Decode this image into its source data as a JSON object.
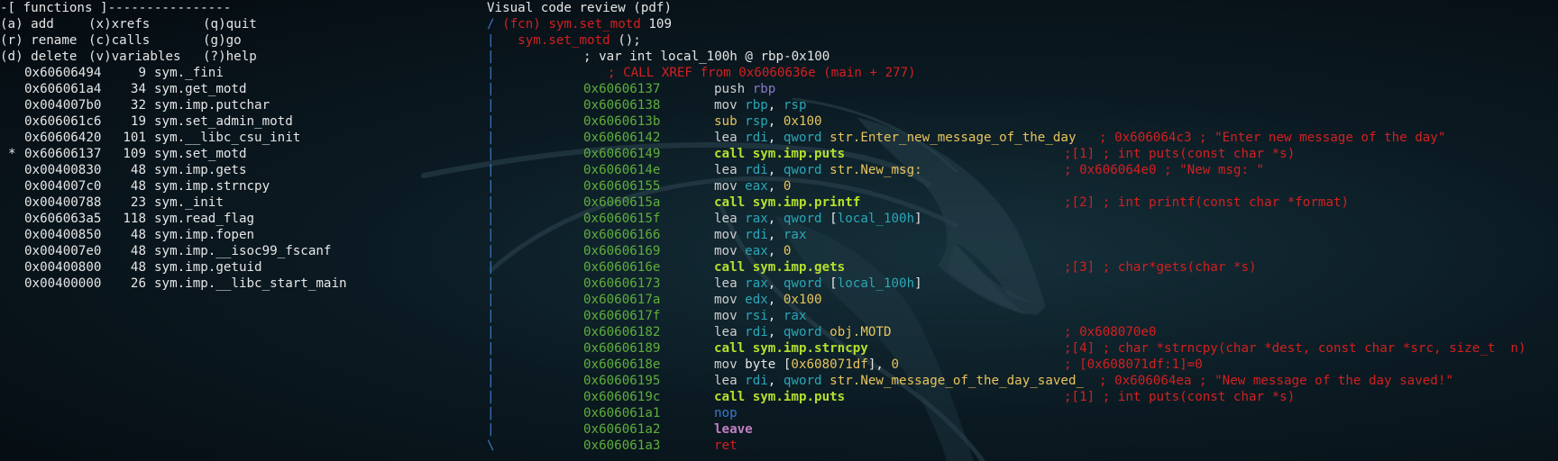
{
  "functions_panel": {
    "header": "-[ functions ]----------------",
    "menu": [
      [
        "(a) add",
        "(x)xrefs",
        "(q)quit"
      ],
      [
        "(r) rename",
        "(c)calls",
        "(g)go"
      ],
      [
        "(d) delete",
        "(v)variables",
        "(?)help"
      ]
    ],
    "list": [
      {
        "marker": "",
        "addr": "0x60606494",
        "size": "9",
        "name": "sym._fini"
      },
      {
        "marker": "",
        "addr": "0x606061a4",
        "size": "34",
        "name": "sym.get_motd"
      },
      {
        "marker": "",
        "addr": "0x004007b0",
        "size": "32",
        "name": "sym.imp.putchar"
      },
      {
        "marker": "",
        "addr": "0x606061c6",
        "size": "19",
        "name": "sym.set_admin_motd"
      },
      {
        "marker": "",
        "addr": "0x60606420",
        "size": "101",
        "name": "sym.__libc_csu_init"
      },
      {
        "marker": "*",
        "addr": "0x60606137",
        "size": "109",
        "name": "sym.set_motd"
      },
      {
        "marker": "",
        "addr": "0x00400830",
        "size": "48",
        "name": "sym.imp.gets"
      },
      {
        "marker": "",
        "addr": "0x004007c0",
        "size": "48",
        "name": "sym.imp.strncpy"
      },
      {
        "marker": "",
        "addr": "0x00400788",
        "size": "23",
        "name": "sym._init"
      },
      {
        "marker": "",
        "addr": "0x606063a5",
        "size": "118",
        "name": "sym.read_flag"
      },
      {
        "marker": "",
        "addr": "0x00400850",
        "size": "48",
        "name": "sym.imp.fopen"
      },
      {
        "marker": "",
        "addr": "0x004007e0",
        "size": "48",
        "name": "sym.imp.__isoc99_fscanf"
      },
      {
        "marker": "",
        "addr": "0x00400800",
        "size": "48",
        "name": "sym.imp.getuid"
      },
      {
        "marker": "",
        "addr": "0x00400000",
        "size": "26",
        "name": "sym.imp.__libc_start_main"
      }
    ]
  },
  "code_panel": {
    "title": "Visual code review (pdf)",
    "fcn_line": {
      "prefix": "/ ",
      "fcn": "(fcn) sym.set_motd",
      "size": " 109"
    },
    "sig_line": {
      "bar": "|",
      "name": "sym.set_motd",
      "rest": " ();"
    },
    "var_line": "; var int local_100h @ rbp-0x100",
    "xref_line": "; CALL XREF from 0x6060636e (main + 277)",
    "instructions": [
      {
        "bar": "|",
        "addr": "0x60606137",
        "mn": "push",
        "ops": [
          [
            " ",
            ""
          ],
          [
            "rbp",
            "purple"
          ]
        ],
        "cmt": ""
      },
      {
        "bar": "|",
        "addr": "0x60606138",
        "mn": "mov",
        "ops": [
          [
            " ",
            ""
          ],
          [
            "rbp",
            "cyan"
          ],
          [
            ", ",
            ""
          ],
          [
            "rsp",
            "cyan"
          ]
        ],
        "cmt": ""
      },
      {
        "bar": "|",
        "addr": "0x6060613b",
        "mn": "sub",
        "mnc": "yel",
        "ops": [
          [
            " ",
            ""
          ],
          [
            "rsp",
            "cyan"
          ],
          [
            ", ",
            ""
          ],
          [
            "0x100",
            "yel"
          ]
        ],
        "cmt": ""
      },
      {
        "bar": "|",
        "addr": "0x60606142",
        "mn": "lea",
        "ops": [
          [
            " ",
            ""
          ],
          [
            "rdi",
            "cyan"
          ],
          [
            ", ",
            ""
          ],
          [
            "qword",
            "cyan"
          ],
          [
            " ",
            ""
          ],
          [
            "str.Enter_new_message_of_the_day",
            "yel"
          ]
        ],
        "cmt": " ; 0x606064c3 ; \"Enter new message of the day\""
      },
      {
        "bar": "|",
        "addr": "0x60606149",
        "mn": "call sym.imp.puts",
        "mnc": "lime",
        "ops": [],
        "cmt": ";[1] ; int puts(const char *s)"
      },
      {
        "bar": "|",
        "addr": "0x6060614e",
        "mn": "lea",
        "ops": [
          [
            " ",
            ""
          ],
          [
            "rdi",
            "cyan"
          ],
          [
            ", ",
            ""
          ],
          [
            "qword",
            "cyan"
          ],
          [
            " ",
            ""
          ],
          [
            "str.New_msg:",
            "yel"
          ]
        ],
        "cmt": "; 0x606064e0 ; \"New msg: \""
      },
      {
        "bar": "|",
        "addr": "0x60606155",
        "mn": "mov",
        "ops": [
          [
            " ",
            ""
          ],
          [
            "eax",
            "cyan"
          ],
          [
            ", ",
            ""
          ],
          [
            "0",
            "yel"
          ]
        ],
        "cmt": ""
      },
      {
        "bar": "|",
        "addr": "0x6060615a",
        "mn": "call sym.imp.printf",
        "mnc": "lime",
        "ops": [],
        "cmt": ";[2] ; int printf(const char *format)"
      },
      {
        "bar": "|",
        "addr": "0x6060615f",
        "mn": "lea",
        "ops": [
          [
            " ",
            ""
          ],
          [
            "rax",
            "cyan"
          ],
          [
            ", ",
            ""
          ],
          [
            "qword",
            "cyan"
          ],
          [
            " [",
            ""
          ],
          [
            "local_100h",
            "cyan"
          ],
          [
            "]",
            ""
          ]
        ],
        "cmt": ""
      },
      {
        "bar": "|",
        "addr": "0x60606166",
        "mn": "mov",
        "ops": [
          [
            " ",
            ""
          ],
          [
            "rdi",
            "cyan"
          ],
          [
            ", ",
            ""
          ],
          [
            "rax",
            "cyan"
          ]
        ],
        "cmt": ""
      },
      {
        "bar": "|",
        "addr": "0x60606169",
        "mn": "mov",
        "ops": [
          [
            " ",
            ""
          ],
          [
            "eax",
            "cyan"
          ],
          [
            ", ",
            ""
          ],
          [
            "0",
            "yel"
          ]
        ],
        "cmt": ""
      },
      {
        "bar": "|",
        "addr": "0x6060616e",
        "mn": "call sym.imp.gets",
        "mnc": "lime",
        "ops": [],
        "cmt": ";[3] ; char*gets(char *s)"
      },
      {
        "bar": "|",
        "addr": "0x60606173",
        "mn": "lea",
        "ops": [
          [
            " ",
            ""
          ],
          [
            "rax",
            "cyan"
          ],
          [
            ", ",
            ""
          ],
          [
            "qword",
            "cyan"
          ],
          [
            " [",
            ""
          ],
          [
            "local_100h",
            "cyan"
          ],
          [
            "]",
            ""
          ]
        ],
        "cmt": ""
      },
      {
        "bar": "|",
        "addr": "0x6060617a",
        "mn": "mov",
        "ops": [
          [
            " ",
            ""
          ],
          [
            "edx",
            "cyan"
          ],
          [
            ", ",
            ""
          ],
          [
            "0x100",
            "yel"
          ]
        ],
        "cmt": ""
      },
      {
        "bar": "|",
        "addr": "0x6060617f",
        "mn": "mov",
        "ops": [
          [
            " ",
            ""
          ],
          [
            "rsi",
            "cyan"
          ],
          [
            ", ",
            ""
          ],
          [
            "rax",
            "cyan"
          ]
        ],
        "cmt": ""
      },
      {
        "bar": "|",
        "addr": "0x60606182",
        "mn": "lea",
        "ops": [
          [
            " ",
            ""
          ],
          [
            "rdi",
            "cyan"
          ],
          [
            ", ",
            ""
          ],
          [
            "qword",
            "cyan"
          ],
          [
            " ",
            ""
          ],
          [
            "obj.MOTD",
            "yel"
          ]
        ],
        "cmt": "; 0x608070e0"
      },
      {
        "bar": "|",
        "addr": "0x60606189",
        "mn": "call sym.imp.strncpy",
        "mnc": "lime",
        "ops": [],
        "cmt": ";[4] ; char *strncpy(char *dest, const char *src, size_t  n)"
      },
      {
        "bar": "|",
        "addr": "0x6060618e",
        "mn": "mov",
        "ops": [
          [
            " byte [",
            ""
          ],
          [
            "0x608071df",
            "yel"
          ],
          [
            "], ",
            ""
          ],
          [
            "0",
            "yel"
          ]
        ],
        "cmt": "; [0x608071df:1]=0"
      },
      {
        "bar": "|",
        "addr": "0x60606195",
        "mn": "lea",
        "ops": [
          [
            " ",
            ""
          ],
          [
            "rdi",
            "cyan"
          ],
          [
            ", ",
            ""
          ],
          [
            "qword",
            "cyan"
          ],
          [
            " ",
            ""
          ],
          [
            "str.New_message_of_the_day_saved_",
            "yel"
          ]
        ],
        "cmt": " ; 0x606064ea ; \"New message of the day saved!\""
      },
      {
        "bar": "|",
        "addr": "0x6060619c",
        "mn": "call sym.imp.puts",
        "mnc": "lime",
        "ops": [],
        "cmt": ";[1] ; int puts(const char *s)"
      },
      {
        "bar": "|",
        "addr": "0x606061a1",
        "mn": "nop",
        "mnc": "blue",
        "ops": [],
        "cmt": ""
      },
      {
        "bar": "|",
        "addr": "0x606061a2",
        "mn": "leave",
        "mnc": "mag",
        "ops": [],
        "cmt": ""
      },
      {
        "bar": "\\",
        "addr": "0x606061a3",
        "mn": "ret",
        "mnc": "red",
        "ops": [],
        "cmt": ""
      }
    ]
  },
  "colors": {
    "background": "#0b1a22",
    "text": "#d3d3d3",
    "address": "#5fae3a",
    "comment": "#d22020",
    "register": "#2aa7b8",
    "immediate": "#e8c45a",
    "call": "#b5e02c"
  },
  "background_image": "kali-dragon-watermark"
}
